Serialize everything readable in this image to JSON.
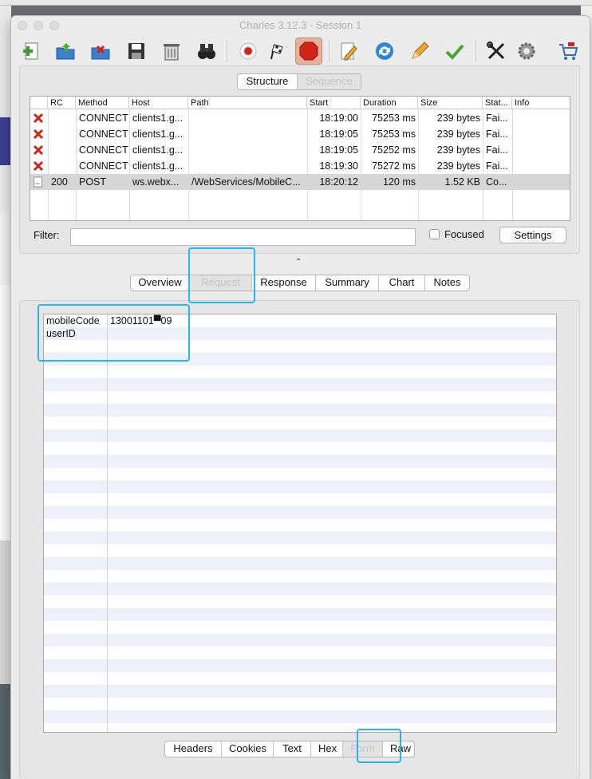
{
  "window": {
    "title": "Charles 3.12.3 - Session 1"
  },
  "toolbar": {
    "buttons": [
      {
        "name": "new-session-icon"
      },
      {
        "name": "open-session-icon"
      },
      {
        "name": "close-session-icon"
      },
      {
        "name": "save-session-icon"
      },
      {
        "name": "clear-session-icon"
      },
      {
        "name": "find-icon"
      },
      {
        "name": "record-icon"
      },
      {
        "name": "throttle-icon"
      },
      {
        "name": "breakpoints-icon"
      },
      {
        "name": "compose-icon"
      },
      {
        "name": "repeat-icon"
      },
      {
        "name": "edit-icon"
      },
      {
        "name": "validate-icon"
      },
      {
        "name": "tools-icon"
      },
      {
        "name": "settings-icon"
      },
      {
        "name": "shop-icon"
      }
    ]
  },
  "view_tabs": [
    "Structure",
    "Sequence"
  ],
  "session_table": {
    "columns": [
      "RC",
      "Method",
      "Host",
      "Path",
      "Start",
      "Duration",
      "Size",
      "Stat...",
      "Info"
    ],
    "rows": [
      {
        "status_icon": "error-x-icon",
        "rc": "",
        "method": "CONNECT",
        "host": "clients1.g...",
        "path": "",
        "start": "18:19:00",
        "duration": "75253 ms",
        "size": "239 bytes",
        "status": "Fai...",
        "info": ""
      },
      {
        "status_icon": "error-x-icon",
        "rc": "",
        "method": "CONNECT",
        "host": "clients1.g...",
        "path": "",
        "start": "18:19:05",
        "duration": "75253 ms",
        "size": "239 bytes",
        "status": "Fai...",
        "info": ""
      },
      {
        "status_icon": "error-x-icon",
        "rc": "",
        "method": "CONNECT",
        "host": "clients1.g...",
        "path": "",
        "start": "18:19:05",
        "duration": "75252 ms",
        "size": "239 bytes",
        "status": "Fai...",
        "info": ""
      },
      {
        "status_icon": "error-x-icon",
        "rc": "",
        "method": "CONNECT",
        "host": "clients1.g...",
        "path": "",
        "start": "18:19:30",
        "duration": "75272 ms",
        "size": "239 bytes",
        "status": "Fai...",
        "info": ""
      },
      {
        "status_icon": "document-icon",
        "rc": "200",
        "method": "POST",
        "host": "ws.webx...",
        "path": "/WebServices/MobileC...",
        "start": "18:20:12",
        "duration": "120 ms",
        "size": "1.52 KB",
        "status": "Co...",
        "info": ""
      }
    ]
  },
  "filter": {
    "label": "Filter:",
    "value": "",
    "focused_label": "Focused",
    "settings_label": "Settings"
  },
  "detail_tabs": [
    "Overview",
    "Request",
    "Response",
    "Summary",
    "Chart",
    "Notes"
  ],
  "form": {
    "rows": [
      {
        "name": "mobileCode",
        "value": "13001101▀09"
      },
      {
        "name": "userID",
        "value": ""
      }
    ]
  },
  "bottom_tabs": [
    "Headers",
    "Cookies",
    "Text",
    "Hex",
    "Form",
    "Raw"
  ],
  "colors": {
    "highlight": "#2ab5ea",
    "error": "#d0241b",
    "selected_row": "#d6d6d6"
  }
}
